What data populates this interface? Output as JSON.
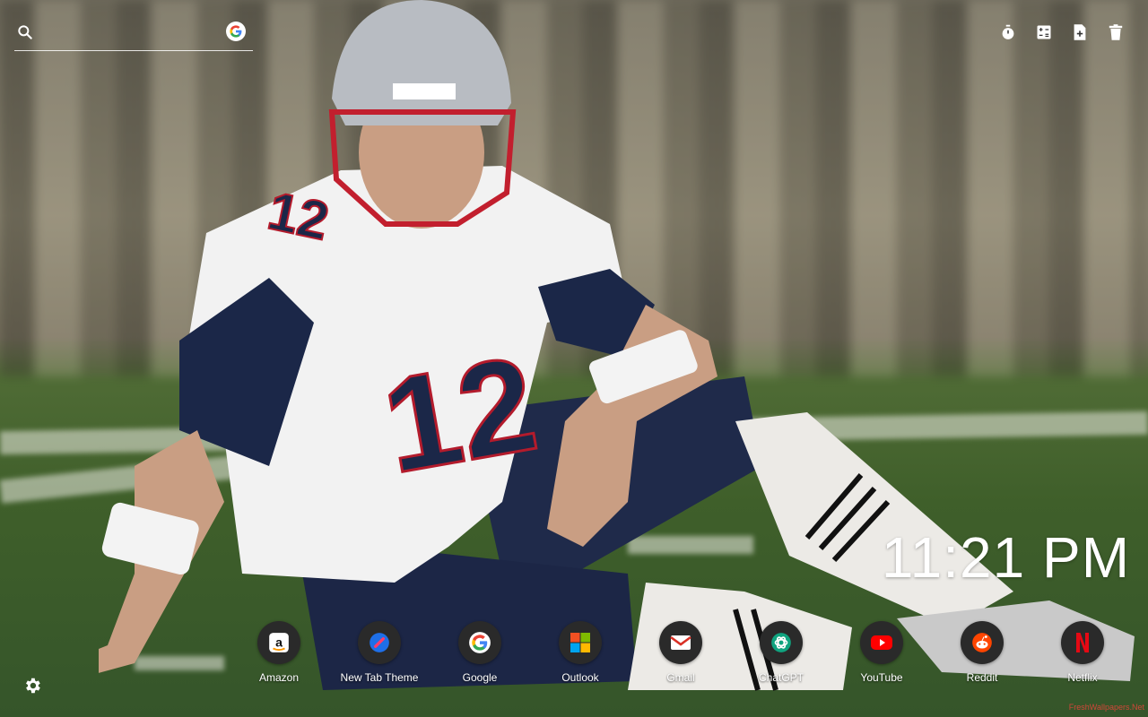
{
  "search": {
    "placeholder": "",
    "engine_icon": "google-g-icon"
  },
  "toolbar": {
    "items": [
      {
        "name": "timer",
        "icon": "stopwatch-icon"
      },
      {
        "name": "calculator",
        "icon": "calculator-icon"
      },
      {
        "name": "notes",
        "icon": "add-note-icon"
      },
      {
        "name": "delete",
        "icon": "trash-icon"
      }
    ]
  },
  "clock": {
    "time": "11:21 PM"
  },
  "shortcuts": [
    {
      "label": "Amazon",
      "icon": "amazon-icon",
      "color": "#ffffff"
    },
    {
      "label": "New Tab Theme",
      "icon": "new-tab-theme-icon",
      "color": "#1e6fe8"
    },
    {
      "label": "Google",
      "icon": "google-icon",
      "color": "#4285F4"
    },
    {
      "label": "Outlook",
      "icon": "windows-logo-icon",
      "color": "#f25022"
    },
    {
      "label": "Gmail",
      "icon": "gmail-icon",
      "color": "#d93025"
    },
    {
      "label": "ChatGPT",
      "icon": "chatgpt-icon",
      "color": "#10a37f"
    },
    {
      "label": "YouTube",
      "icon": "youtube-icon",
      "color": "#ff0000"
    },
    {
      "label": "Reddit",
      "icon": "reddit-icon",
      "color": "#ff4500"
    },
    {
      "label": "Netflix",
      "icon": "netflix-icon",
      "color": "#e50914"
    }
  ],
  "settings": {
    "icon": "gear-icon"
  },
  "watermark": {
    "text": "FreshWallpapers.Net"
  }
}
